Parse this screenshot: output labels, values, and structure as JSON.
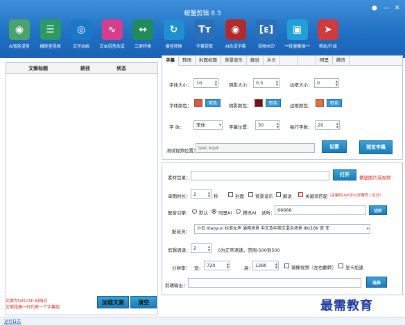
{
  "window": {
    "title": "螃蟹剪辑 8.3",
    "controls": [
      "●",
      "—",
      "✕"
    ]
  },
  "toolbar": [
    {
      "label": "AI智能混剪",
      "icon": "brain-icon",
      "color": "#4aa36a",
      "glyph": "◉"
    },
    {
      "label": "横转竖视频",
      "icon": "layout-icon",
      "color": "#2a9a62",
      "glyph": "☰"
    },
    {
      "label": "文字动画",
      "icon": "globe-icon",
      "color": "#1d77c8",
      "glyph": "◎"
    },
    {
      "label": "文本语音合成",
      "icon": "waveform-icon",
      "color": "#d83c8c",
      "glyph": "∿"
    },
    {
      "label": "三屏转换",
      "icon": "split-icon",
      "color": "#1f8c5a",
      "glyph": "↔"
    },
    {
      "label": "横竖转换",
      "icon": "rotate-icon",
      "color": "#1e8fcf",
      "glyph": "↻"
    },
    {
      "label": "字幕提取",
      "icon": "text-icon",
      "color": "#2a6fb8",
      "glyph": "Tᴛ"
    },
    {
      "label": "AI合成字幕",
      "icon": "record-icon",
      "color": "#b22a2a",
      "glyph": "◉"
    },
    {
      "label": "视频水印",
      "icon": "watermark-icon",
      "color": "#2a6fb8",
      "glyph": "[ᴇ]"
    },
    {
      "label": "**批量集锦**",
      "icon": "camera-icon",
      "color": "#1fa0d8",
      "glyph": "▣"
    },
    {
      "label": "帮助/升级",
      "icon": "rocket-icon",
      "color": "#d03a3a",
      "glyph": "➤"
    }
  ],
  "left": {
    "headers": [
      "文案标题",
      "路径",
      "状态"
    ],
    "notes": [
      "文案为txt(UTF-8)格式",
      "文案段落一行代表一个字幕组"
    ],
    "load_btn": "加载文案",
    "clear_btn": "清空"
  },
  "tabs": [
    "字幕",
    "转场",
    "封面标题",
    "背景音乐",
    "解说",
    "片头",
    "",
    "",
    "阿里",
    "腾讯"
  ],
  "subtitle": {
    "font_size_label": "字体大小：",
    "font_size": "10",
    "shadow_size_label": "阴影大小：",
    "shadow_size": "0.5",
    "border_size_label": "边框大小：",
    "border_size": "0",
    "font_color_label": "字体颜色：",
    "font_color": "#e8543a",
    "shadow_color_label": "阴影颜色：",
    "shadow_color": "#7a0f12",
    "border_color_label": "边框颜色：",
    "border_color": "#ef6a3a",
    "color_btn": "取色",
    "font_label": "字    体：",
    "font": "宋体",
    "position_label": "字幕位置：",
    "position": "30",
    "perline_label": "每行字数：",
    "perline": "20",
    "test_label": "测试视频位置：",
    "test_value": "test.mp4",
    "set_btn": "设置",
    "preview_btn": "预览字幕"
  },
  "material": {
    "dir_label": "素材目录：",
    "dir_value": "",
    "open_btn": "打开",
    "open_hint": "横竖图片或视频",
    "duration_label": "单图时长：",
    "duration": "2",
    "sec": "秒",
    "cover": "封面",
    "bgm": "背景音乐",
    "narration": "解说",
    "keyword": "关键词匹配",
    "keyword_hint": "（关键词.txt中以分隔符 | 区分）",
    "engine_label": "配音引擎：",
    "engine_default": "默认",
    "engine_ali": "阿里AI",
    "engine_tencent": "腾讯AI",
    "audition_label": "试听：",
    "audition": "66666",
    "audition_btn": "试听",
    "voice_label": "配音员：",
    "voice": "小云 Xiaoyun 标准女声 通用场景 中文及中英文混合场景 8K/16K 否 无",
    "speed_label": "剪辑语速：",
    "speed": "2",
    "speed_hint": "0为正常语速，范围-500到500",
    "res_label": "分辨率：",
    "width_label": "宽：",
    "width": "720",
    "height_label": "高：",
    "height": "1280",
    "mirror": "镜像视频（左右翻转）",
    "gpu": "显卡加速",
    "out_label": "剪辑输出：",
    "out_value": "",
    "out_btn": "选择"
  },
  "watermark": "最需教育",
  "status": "运行日志"
}
